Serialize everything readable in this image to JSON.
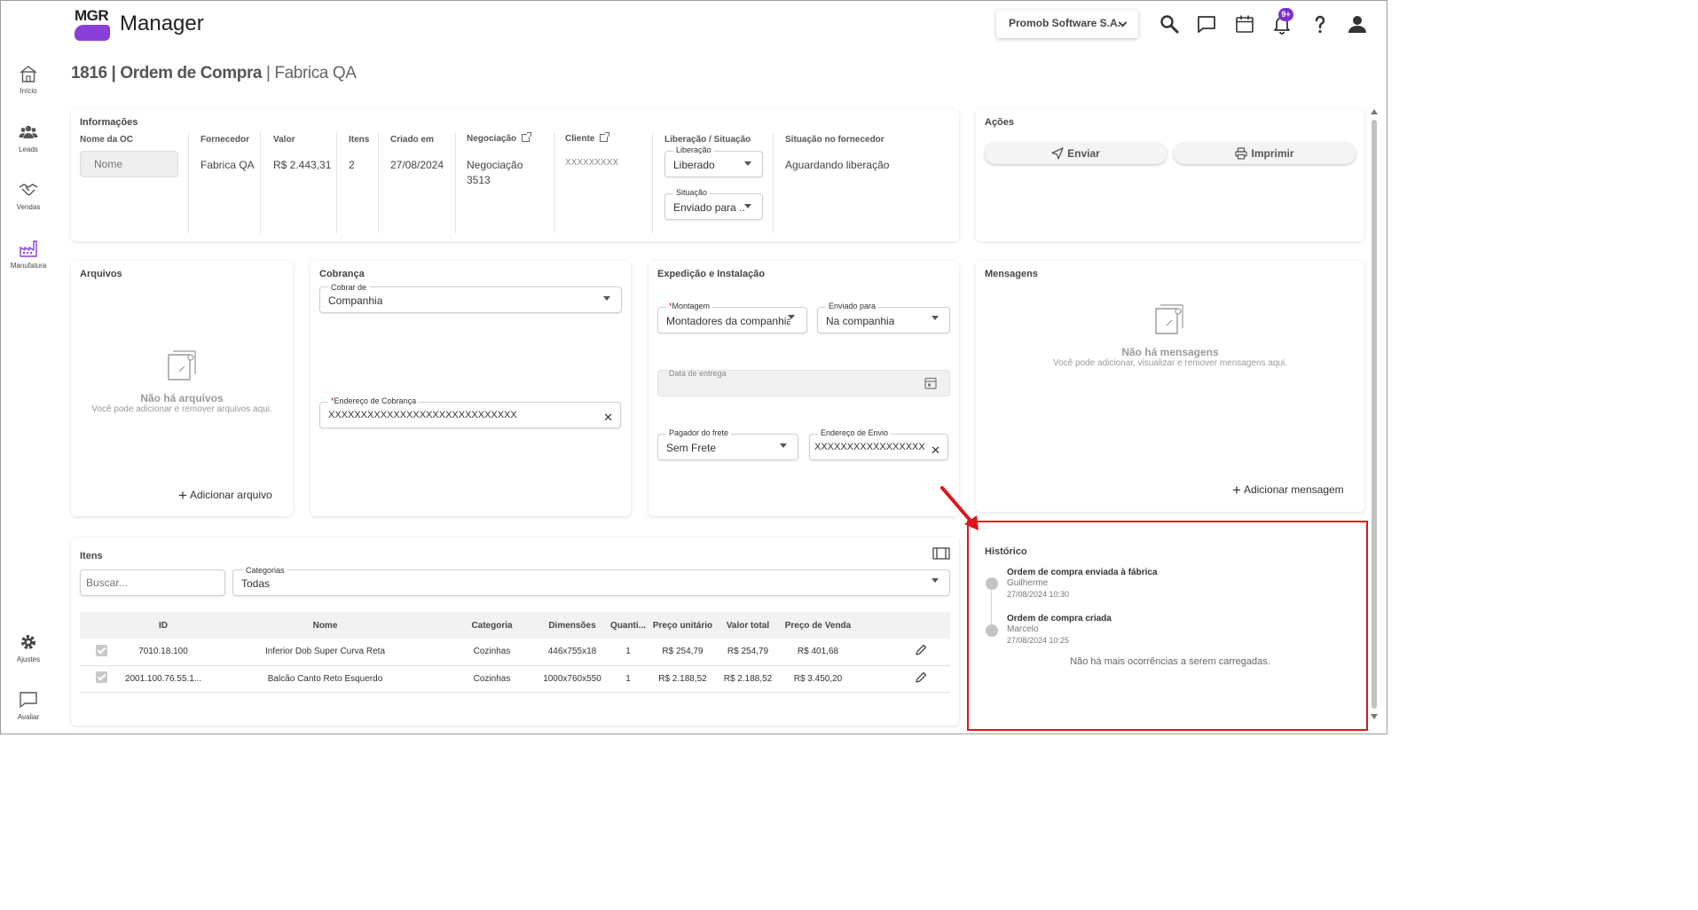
{
  "header": {
    "logo_text": "MGR",
    "app_name": "Manager",
    "company": "Promob Software S.A.",
    "notifications_badge": "9+"
  },
  "sidebar": {
    "items": [
      {
        "label": "Início"
      },
      {
        "label": "Leads"
      },
      {
        "label": "Vendas"
      },
      {
        "label": "Manufatura"
      },
      {
        "label": "Ajustes"
      },
      {
        "label": "Avaliar"
      }
    ]
  },
  "page": {
    "title_number": "1816 | Ordem de Compra",
    "title_separator": " | ",
    "title_company": "Fabrica QA"
  },
  "informacoes": {
    "title": "Informações",
    "nome_oc_label": "Nome da OC",
    "nome_oc_placeholder": "Nome",
    "fornecedor_label": "Fornecedor",
    "fornecedor_value": "Fabrica QA",
    "valor_label": "Valor",
    "valor_value": "R$ 2.443,31",
    "itens_label": "Itens",
    "itens_value": "2",
    "criado_label": "Criado em",
    "criado_value": "27/08/2024",
    "negociacao_label": "Negociação",
    "negociacao_value_1": "Negociação",
    "negociacao_value_2": "3513",
    "cliente_label": "Cliente",
    "cliente_value": "XXXXXXXXX",
    "liberacao_situacao_label": "Liberação / Situação",
    "liberacao_field_label": "Liberação",
    "liberacao_field_value": "Liberado",
    "situacao_field_label": "Situação",
    "situacao_field_value": "Enviado para ...",
    "situacao_fornecedor_label": "Situação no fornecedor",
    "situacao_fornecedor_value": "Aguardando liberação"
  },
  "acoes": {
    "title": "Ações",
    "enviar": "Enviar",
    "imprimir": "Imprimir"
  },
  "arquivos": {
    "title": "Arquivos",
    "empty_title": "Não há arquivos",
    "empty_sub": "Você pode adicionar e remover arquivos aqui.",
    "add": "Adicionar arquivo"
  },
  "cobranca": {
    "title": "Cobrança",
    "cobrar_de_label": "Cobrar de",
    "cobrar_de_value": "Companhia",
    "endereco_label": "Endereço de Cobrança",
    "endereco_value": "XXXXXXXXXXXXXXXXXXXXXXXXXXXXX"
  },
  "expedicao": {
    "title": "Expedição e Instalação",
    "montagem_label": "Montagem",
    "montagem_value": "Montadores da companhia",
    "enviado_label": "Enviado para",
    "enviado_value": "Na companhia",
    "data_entrega_label": "Data de entrega",
    "pagador_label": "Pagador do frete",
    "pagador_value": "Sem Frete",
    "endereco_envio_label": "Endereço de Envio",
    "endereco_envio_value": "XXXXXXXXXXXXXXXXX"
  },
  "mensagens": {
    "title": "Mensagens",
    "empty_title": "Não há mensagens",
    "empty_sub": "Você pode adicionar, visualizar e remover mensagens aqui.",
    "add": "Adicionar mensagem"
  },
  "itens": {
    "title": "Itens",
    "search_placeholder": "Buscar...",
    "categorias_label": "Categorias",
    "categorias_value": "Todas",
    "columns": [
      "ID",
      "Nome",
      "Categoria",
      "Dimensões",
      "Quanti...",
      "Preço unitário",
      "Valor total",
      "Preço de Venda"
    ],
    "rows": [
      [
        "7010.18.100",
        "Inferior Dob Super Curva Reta",
        "Cozinhas",
        "446x755x18",
        "1",
        "R$ 254,79",
        "R$ 254,79",
        "R$ 401,68"
      ],
      [
        "2001.100.76.55.1...",
        "Balcão Canto Reto Esquerdo",
        "Cozinhas",
        "1000x760x550",
        "1",
        "R$ 2.188,52",
        "R$ 2.188,52",
        "R$ 3.450,20"
      ]
    ]
  },
  "historico": {
    "title": "Histórico",
    "entries": [
      {
        "title": "Ordem de compra enviada à fábrica",
        "user": "Guilherme",
        "time": "27/08/2024 10:30"
      },
      {
        "title": "Ordem de compra criada",
        "user": "Marcelo",
        "time": "27/08/2024 10:25"
      }
    ],
    "end_text": "Não há mais ocorrências a serem carregadas."
  },
  "colors": {
    "brand": "#8b3fd9",
    "badge": "#7d2fd0",
    "annotation": "#e0141c"
  }
}
